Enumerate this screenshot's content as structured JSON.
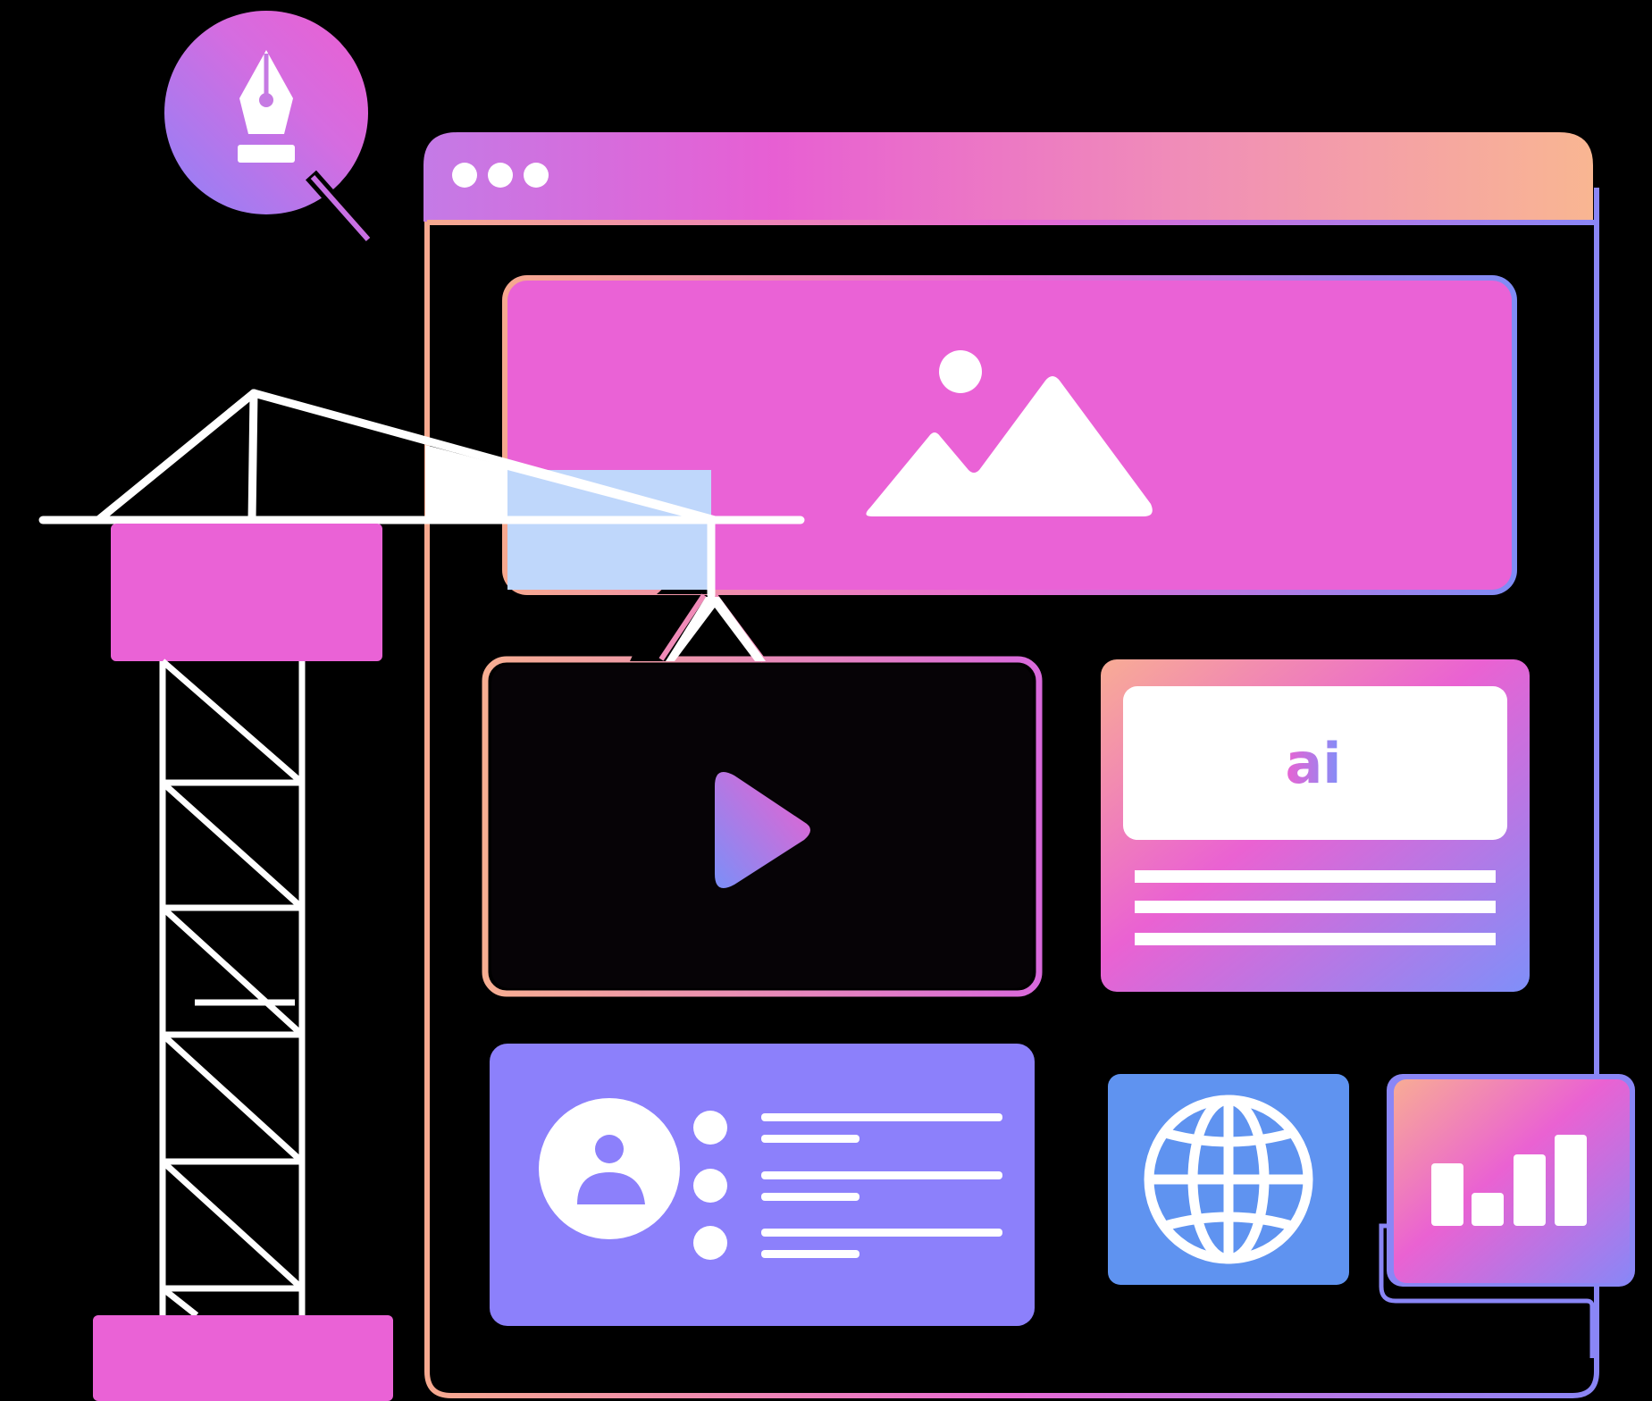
{
  "illustration": {
    "ai_badge_text": "ai",
    "gradient": {
      "violet": "#8b80f9",
      "magenta": "#e85fd4",
      "pink": "#f08bb8",
      "peach": "#f9b494",
      "blue": "#5f93f0",
      "light_blue": "#bfd7fb"
    },
    "icons": [
      "pen-tool-icon",
      "window-dots-icon",
      "image-icon",
      "play-icon",
      "user-avatar-icon",
      "globe-icon",
      "bar-chart-icon",
      "crane-icon"
    ]
  }
}
